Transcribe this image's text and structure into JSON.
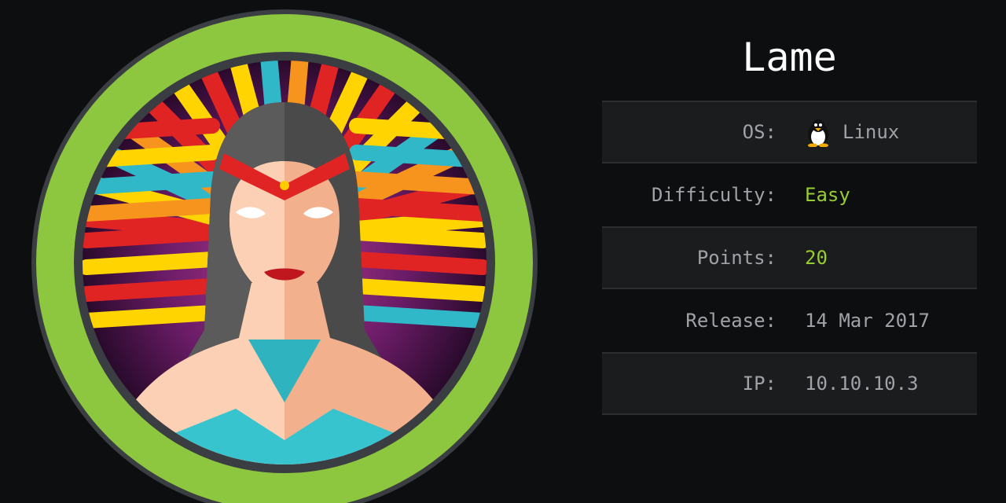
{
  "machine": {
    "name": "Lame"
  },
  "info": {
    "os_label": "OS:",
    "os_value": "Linux",
    "os_icon": "linux-tux-icon",
    "difficulty_label": "Difficulty:",
    "difficulty_value": "Easy",
    "points_label": "Points:",
    "points_value": "20",
    "release_label": "Release:",
    "release_value": "14 Mar 2017",
    "ip_label": "IP:",
    "ip_value": "10.10.10.3"
  },
  "colors": {
    "background": "#0d0e10",
    "avatar_ring": "#8dc63f",
    "accent_green": "#99cc33",
    "row_shade": "#1a1c1e",
    "label_text": "#9fa3a7",
    "title_text": "#ffffff"
  }
}
